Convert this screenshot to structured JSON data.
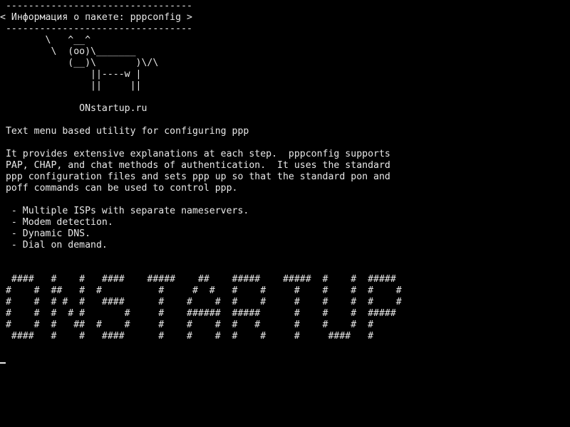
{
  "terminal": {
    "header_rule_top": " ---------------------------------",
    "header_title": "< Информация о пакете: pppconfig >",
    "header_rule_bottom": " ---------------------------------",
    "cow": [
      "        \\   ^__^",
      "         \\  (oo)\\_______",
      "            (__)\\       )\\/\\",
      "                ||----w |",
      "                ||     ||"
    ],
    "site": "              ONstartup.ru",
    "summary": " Text menu based utility for configuring ppp",
    "description": [
      " It provides extensive explanations at each step.  pppconfig supports",
      " PAP, CHAP, and chat methods of authentication.  It uses the standard",
      " ppp configuration files and sets ppp up so that the standard pon and",
      " poff commands can be used to control ppp."
    ],
    "features": [
      "  - Multiple ISPs with separate nameservers.",
      "  - Modem detection.",
      "  - Dynamic DNS.",
      "  - Dial on demand."
    ],
    "banner": [
      "  ####   #    #   ####    #####    ##    #####    #####  #    #  #####",
      " #    #  ##   #  #          #     #  #   #    #     #    #    #  #    #",
      " #    #  # #  #   ####      #    #    #  #    #     #    #    #  #    #",
      " #    #  #  # #       #     #    ######  #####      #    #    #  #####",
      " #    #  #   ##  #    #     #    #    #  #   #      #    #    #  #",
      "  ####   #    #   ####      #    #    #  #    #     #     ####   #"
    ]
  }
}
